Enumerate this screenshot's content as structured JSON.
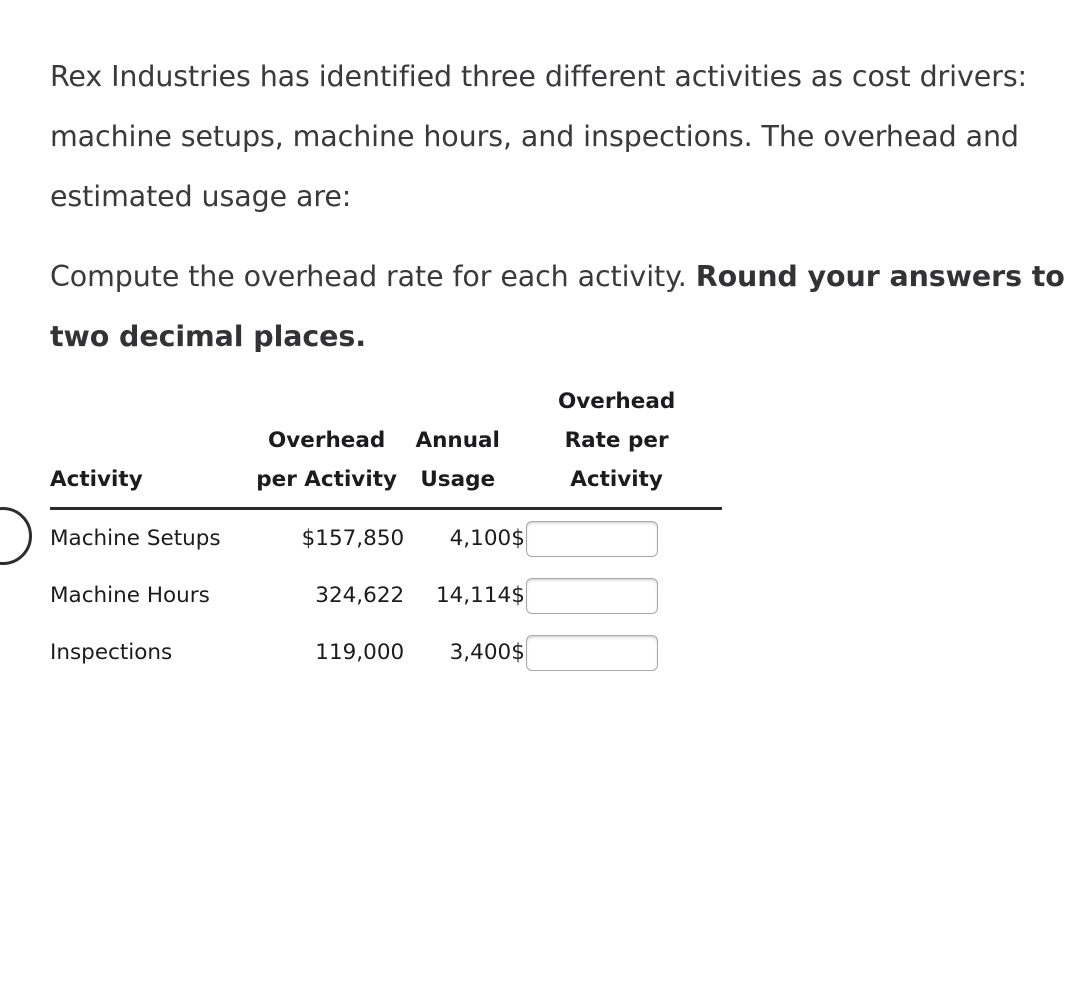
{
  "question": {
    "intro": "Rex Industries has identified three different activities as cost drivers: machine setups, machine hours, and inspections. The overhead and estimated usage are:",
    "instruction_plain": "Compute the overhead rate for each activity. ",
    "instruction_bold": "Round your answers to two decimal places."
  },
  "table": {
    "headers": {
      "activity": "Activity",
      "overhead_per_activity": "Overhead\nper Activity",
      "annual_usage": "Annual\nUsage",
      "overhead_rate_per_activity": "Overhead\nRate per\nActivity"
    },
    "rows": [
      {
        "activity": "Machine Setups",
        "overhead_per_activity": "$157,850",
        "annual_usage": "4,100",
        "rate_prefix": "$",
        "rate_value": "",
        "rate_placeholder": ""
      },
      {
        "activity": "Machine Hours",
        "overhead_per_activity": "324,622",
        "annual_usage": "14,114",
        "rate_prefix": "$",
        "rate_value": "",
        "rate_placeholder": ""
      },
      {
        "activity": "Inspections",
        "overhead_per_activity": "119,000",
        "annual_usage": "3,400",
        "rate_prefix": "$",
        "rate_value": "",
        "rate_placeholder": ""
      }
    ]
  },
  "icons": {
    "edge_circle": "circle-icon"
  },
  "colors": {
    "body_text": "#3a3a3c",
    "table_text": "#1c1c1e",
    "rule": "#2b2b2b",
    "input_border": "#a8a8a8",
    "background": "#ffffff"
  }
}
